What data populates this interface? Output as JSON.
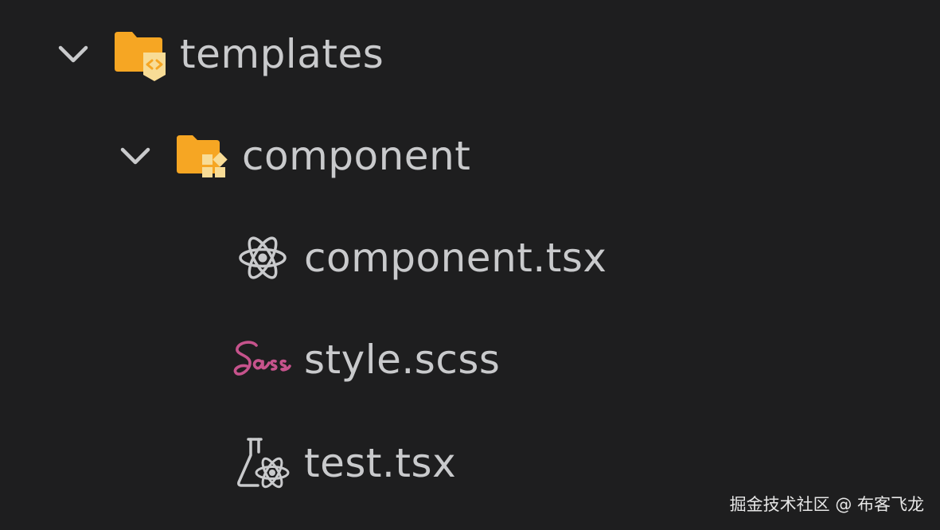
{
  "tree": {
    "items": [
      {
        "label": "templates",
        "icon": "folder-templates-icon",
        "expanded": true,
        "depth": 0
      },
      {
        "label": "component",
        "icon": "folder-component-icon",
        "expanded": true,
        "depth": 1
      },
      {
        "label": "component.tsx",
        "icon": "react-icon",
        "depth": 2
      },
      {
        "label": "style.scss",
        "icon": "sass-icon",
        "depth": 2
      },
      {
        "label": "test.tsx",
        "icon": "test-react-icon",
        "depth": 2
      }
    ]
  },
  "watermark": {
    "text": "掘金技术社区 @ 布客飞龙"
  },
  "colors": {
    "background": "#1e1e1f",
    "text": "#c9cacc",
    "folder": "#f6a623",
    "folder_badge": "#f8dc96",
    "sass": "#c6538c"
  }
}
